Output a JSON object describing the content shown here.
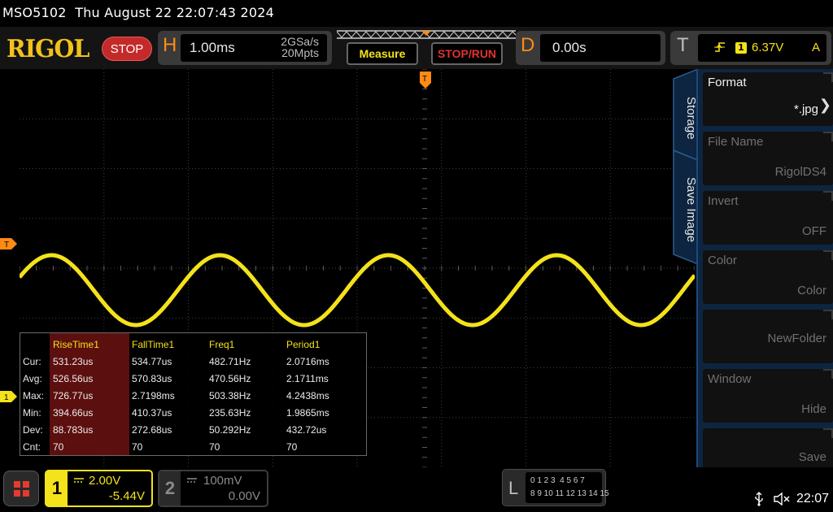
{
  "window": {
    "title": "MSO5102  Thu August 22 22:07:43 2024"
  },
  "brand": {
    "logo": "RIGOL"
  },
  "run_state": {
    "label": "STOP"
  },
  "horizontal": {
    "letter": "H",
    "timebase": "1.00ms",
    "sample_rate": "2GSa/s",
    "memory_depth": "20Mpts"
  },
  "buttons": {
    "measure": "Measure",
    "stop_run": "STOP/RUN"
  },
  "delay": {
    "letter": "D",
    "value": "0.00s"
  },
  "trigger": {
    "letter": "T",
    "source": "1",
    "level": "6.37V",
    "mode": "A",
    "edge_icon": "rising-edge-icon"
  },
  "markers": {
    "trigger": "T",
    "channel1": "1",
    "trigger_pos": "T"
  },
  "measurements": {
    "columns": [
      "RiseTime1",
      "FallTime1",
      "Freq1",
      "Period1"
    ],
    "rows": [
      {
        "label": "Cur:",
        "values": [
          "531.23us",
          "534.77us",
          "482.71Hz",
          "2.0716ms"
        ]
      },
      {
        "label": "Avg:",
        "values": [
          "526.56us",
          "570.83us",
          "470.56Hz",
          "2.1711ms"
        ]
      },
      {
        "label": "Max:",
        "values": [
          "726.77us",
          "2.7198ms",
          "503.38Hz",
          "4.2438ms"
        ]
      },
      {
        "label": "Min:",
        "values": [
          "394.66us",
          "410.37us",
          "235.63Hz",
          "1.9865ms"
        ]
      },
      {
        "label": "Dev:",
        "values": [
          "88.783us",
          "272.68us",
          "50.292Hz",
          "432.72us"
        ]
      },
      {
        "label": "Cnt:",
        "values": [
          "70",
          "70",
          "70",
          "70"
        ]
      }
    ]
  },
  "side_tabs": [
    "Storage",
    "Save Image"
  ],
  "side_menu": [
    {
      "label": "Format",
      "value": "*.jpg",
      "enabled": true
    },
    {
      "label": "File Name",
      "value": "RigolDS4",
      "enabled": false
    },
    {
      "label": "Invert",
      "value": "OFF",
      "enabled": false
    },
    {
      "label": "Color",
      "value": "Color",
      "enabled": false
    },
    {
      "label": "",
      "value": "NewFolder",
      "enabled": false
    },
    {
      "label": "Window",
      "value": "Hide",
      "enabled": false
    },
    {
      "label": "",
      "value": "Save",
      "enabled": false
    }
  ],
  "channel1": {
    "number": "1",
    "scale": "2.00V",
    "offset": "-5.44V",
    "color": "#f4e21a"
  },
  "channel2": {
    "number": "2",
    "scale": "100mV",
    "offset": "0.00V"
  },
  "logic": {
    "letter": "L",
    "row1": "0 1 2 3  4 5 6 7",
    "row2": "8 9 10 11 12 13 14 15"
  },
  "status": {
    "time": "22:07"
  },
  "waveform": {
    "cycles_visible": 4,
    "color": "#f4e21a"
  }
}
